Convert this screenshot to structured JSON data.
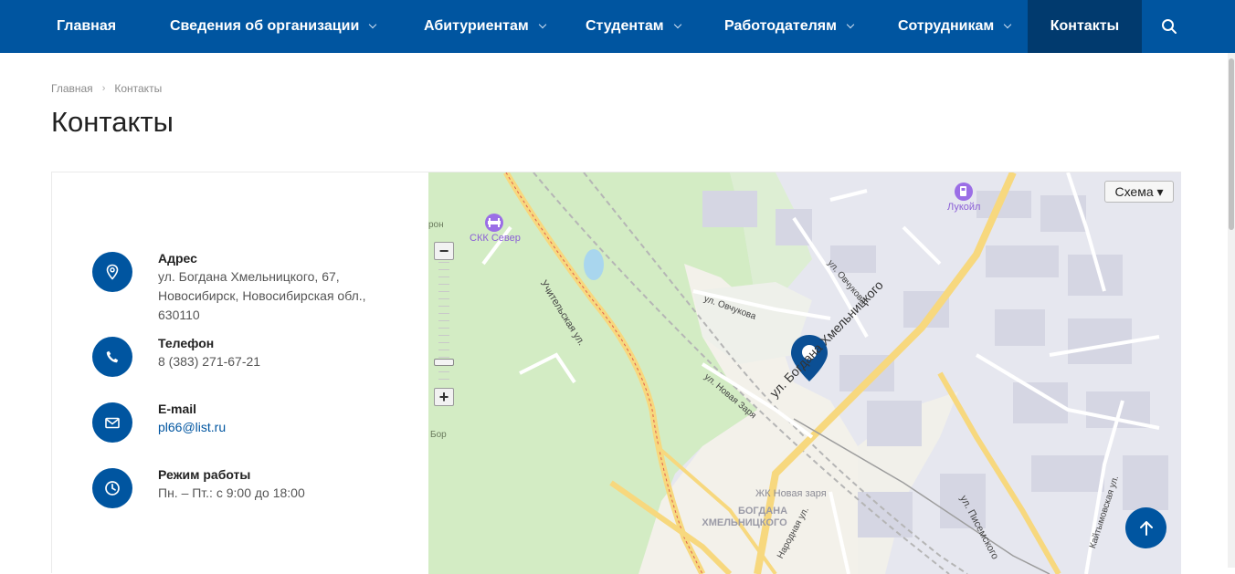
{
  "nav": {
    "items": [
      {
        "label": "Главная"
      },
      {
        "label": "Сведения об организации"
      },
      {
        "label": "Абитуриентам"
      },
      {
        "label": "Студентам"
      },
      {
        "label": "Работодателям"
      },
      {
        "label": "Сотрудникам"
      },
      {
        "label": "Контакты"
      }
    ]
  },
  "breadcrumb": {
    "home": "Главная",
    "current": "Контакты"
  },
  "page": {
    "title": "Контакты"
  },
  "contacts": {
    "address": {
      "label": "Адрес",
      "line1": "ул. Богдана Хмельницкого, 67,",
      "line2": "Новосибирск, Новосибирская обл.,",
      "line3": "630110"
    },
    "phone": {
      "label": "Телефон",
      "value": "8 (383) 271-67-21"
    },
    "email": {
      "label": "E-mail",
      "value": "pl66@list.ru"
    },
    "hours": {
      "label": "Режим работы",
      "value": "Пн. – Пт.: с 9:00 до 18:00"
    }
  },
  "map": {
    "scheme_label": "Схема ▾",
    "zoom_minus": "−",
    "zoom_plus": "+",
    "labels": {
      "skk": "СКК Север",
      "lukoil": "Лукойл",
      "ron": "рон",
      "bor": "Бор",
      "uchitelskaya": "Учительская ул.",
      "ovchukova1": "ул. Овчукова",
      "ovchukova2": "ул. Овчукова",
      "novaya_zarya": "ул. Новая Заря",
      "bogdana_street": "ул. Богдана Хмельницкого",
      "zhk": "ЖК Новая заря",
      "district1": "БОГДАНА",
      "district2": "ХМЕЛЬНИЦКОГО",
      "pisemskogo": "ул. Писемского",
      "narodnaya": "Народная ул.",
      "kaitymovskaya": "Кайтымовская ул."
    },
    "colors": {
      "park": "#d3ecc4",
      "road": "#f7d87e",
      "industrial": "#dcdde8",
      "residential": "#f3f1ea",
      "pin": "#0b4f94"
    }
  },
  "colors": {
    "accent": "#0055a0",
    "accent_dark": "#013a6e"
  }
}
